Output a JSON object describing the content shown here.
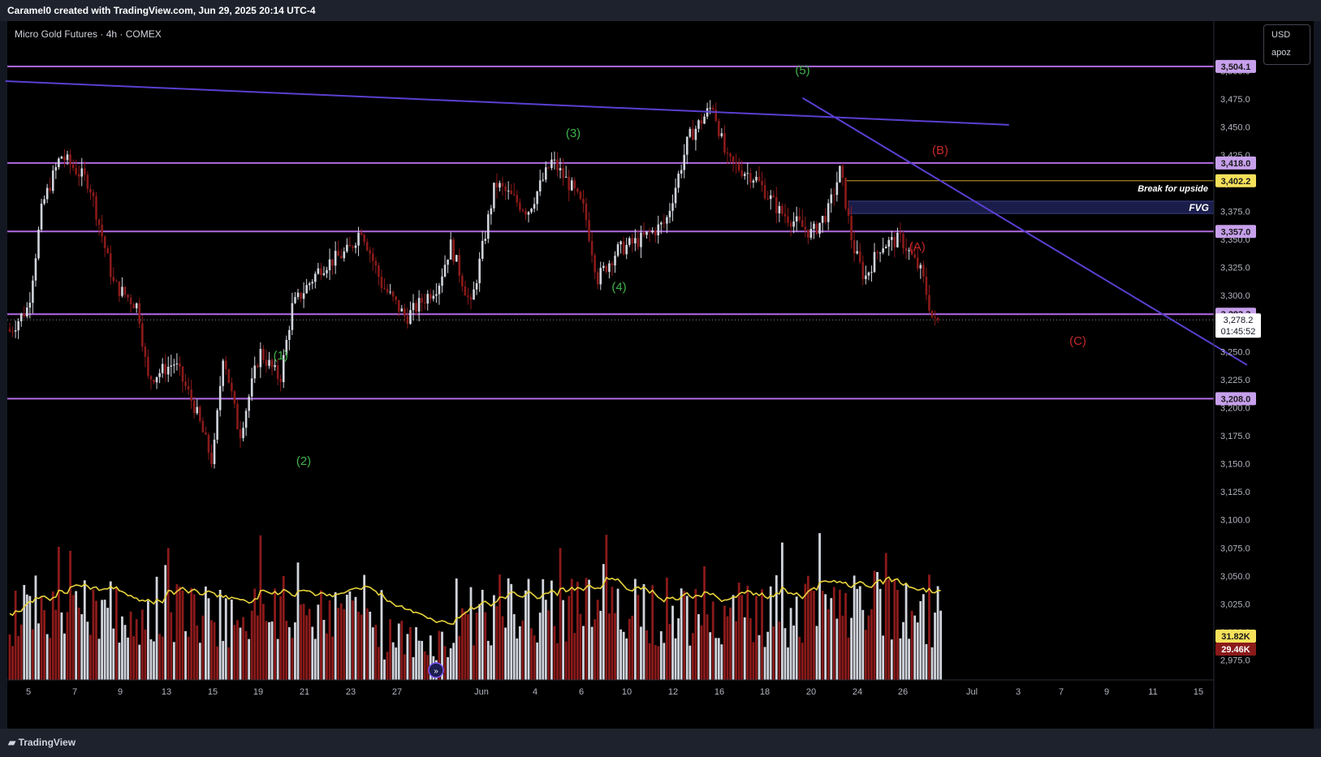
{
  "header": {
    "credit": "Caramel0 created with TradingView.com, Jun 29, 2025 20:14 UTC-4",
    "symbol": "Micro Gold Futures · 4h · COMEX",
    "currency": "USD",
    "scale_mode": "apoz"
  },
  "footer": {
    "logo_text": "TradingView"
  },
  "colors": {
    "background": "#000000",
    "level_line": "#b36ae2",
    "trendline": "#5b3fd1",
    "up_candle": "#d1d4dc",
    "down_candle": "#8b1a1a",
    "volume_ma": "#e8d33c",
    "wave_green": "#3fb24b",
    "wave_red": "#c62828",
    "fvg": "#1a1d4a",
    "break_line": "#c9a227"
  },
  "chart_data": {
    "type": "candlestick",
    "xlabel": "",
    "ylabel": "",
    "ylim": [
      2950,
      3520
    ],
    "x_ticks": [
      "5",
      "7",
      "9",
      "13",
      "15",
      "19",
      "21",
      "23",
      "27",
      "Jun",
      "4",
      "6",
      "10",
      "12",
      "16",
      "18",
      "20",
      "24",
      "26",
      "Jul",
      "3",
      "7",
      "9",
      "11",
      "15"
    ],
    "y_ticks": [
      "2,975.0",
      "3,000.0",
      "3,025.0",
      "3,050.0",
      "3,075.0",
      "3,100.0",
      "3,125.0",
      "3,150.0",
      "3,175.0",
      "3,200.0",
      "3,225.0",
      "3,250.0",
      "3,275.0",
      "3,300.0",
      "3,325.0",
      "3,350.0",
      "3,375.0",
      "3,400.0",
      "3,425.0",
      "3,450.0",
      "3,475.0",
      "3,500.0"
    ],
    "horizontal_levels": [
      {
        "label": "3,504.1",
        "value": 3504.1
      },
      {
        "label": "3,418.0",
        "value": 3418.0
      },
      {
        "label": "3,357.0",
        "value": 3357.0
      },
      {
        "label": "3,283.3",
        "value": 3283.3
      },
      {
        "label": "3,208.0",
        "value": 3208.0
      }
    ],
    "break_level": {
      "label": "3,402.2",
      "value": 3402.2,
      "annotation": "Break for upside"
    },
    "fvg": {
      "label": "FVG",
      "top": 3384,
      "bottom": 3373
    },
    "last_price": {
      "label": "3,278.2",
      "value": 3278.2,
      "countdown": "01:45:52"
    },
    "volume": {
      "ma_label": "31.82K",
      "last_label": "29.46K"
    },
    "wave_labels": [
      {
        "text": "(1)",
        "date": "May 16",
        "price": 3243,
        "color": "green"
      },
      {
        "text": "(2)",
        "date": "May 17",
        "price": 3149,
        "color": "green"
      },
      {
        "text": "(3)",
        "date": "Jun 5",
        "price": 3441,
        "color": "green"
      },
      {
        "text": "(4)",
        "date": "Jun 7",
        "price": 3304,
        "color": "green"
      },
      {
        "text": "(5)",
        "date": "Jun 15",
        "price": 3497,
        "color": "green"
      },
      {
        "text": "(A)",
        "date": "Jun 20",
        "price": 3340,
        "color": "red"
      },
      {
        "text": "(B)",
        "date": "Jun 21",
        "price": 3426,
        "color": "red"
      },
      {
        "text": "(C)",
        "date": "Jun 27",
        "price": 3256,
        "color": "red"
      }
    ],
    "trendlines": [
      {
        "from": {
          "date": "May 4",
          "price": 3491
        },
        "to": {
          "date": "Jun 24",
          "price": 3452
        }
      },
      {
        "from": {
          "date": "Jun 15",
          "price": 3476
        },
        "to": {
          "date": "Jul 13",
          "price": 3238
        }
      }
    ]
  }
}
